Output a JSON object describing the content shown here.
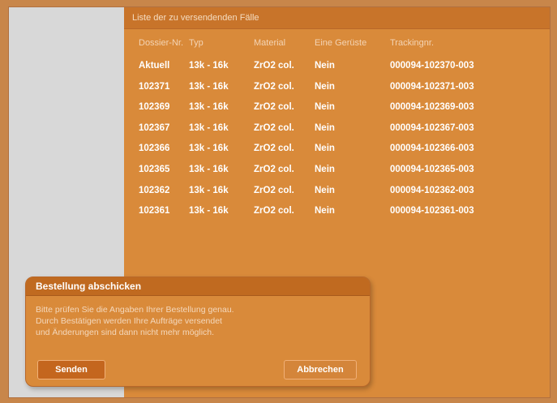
{
  "panel": {
    "title": "Liste der zu versendenden Fälle",
    "columns": [
      "Dossier-Nr.",
      "Typ",
      "Material",
      "Eine Gerüste",
      "Trackingnr."
    ],
    "rows": [
      [
        "Aktuell",
        "13k - 16k",
        "ZrO2 col.",
        "Nein",
        "000094-102370-003"
      ],
      [
        "102371",
        "13k - 16k",
        "ZrO2 col.",
        "Nein",
        "000094-102371-003"
      ],
      [
        "102369",
        "13k - 16k",
        "ZrO2 col.",
        "Nein",
        "000094-102369-003"
      ],
      [
        "102367",
        "13k - 16k",
        "ZrO2 col.",
        "Nein",
        "000094-102367-003"
      ],
      [
        "102366",
        "13k - 16k",
        "ZrO2 col.",
        "Nein",
        "000094-102366-003"
      ],
      [
        "102365",
        "13k - 16k",
        "ZrO2 col.",
        "Nein",
        "000094-102365-003"
      ],
      [
        "102362",
        "13k - 16k",
        "ZrO2 col.",
        "Nein",
        "000094-102362-003"
      ],
      [
        "102361",
        "13k - 16k",
        "ZrO2 col.",
        "Nein",
        "000094-102361-003"
      ]
    ]
  },
  "dialog": {
    "title": "Bestellung abschicken",
    "lines": [
      "Bitte prüfen Sie die Angaben Ihrer Bestellung genau.",
      "Durch Bestätigen werden Ihre Aufträge versendet",
      "und Änderungen sind dann nicht mehr möglich."
    ],
    "send_label": "Senden",
    "cancel_label": "Abbrechen"
  }
}
